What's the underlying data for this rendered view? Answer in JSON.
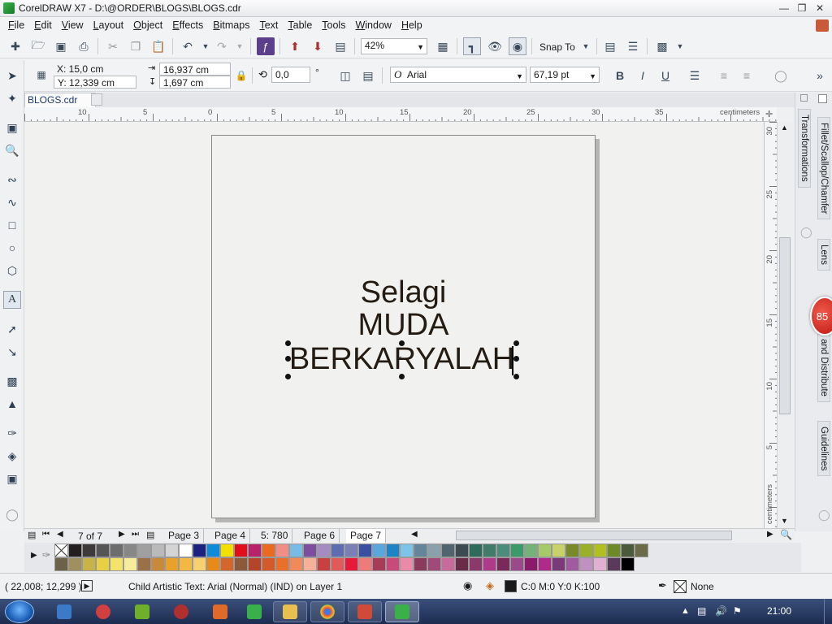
{
  "window": {
    "title": "CorelDRAW X7 - D:\\@ORDER\\BLOGS\\BLOGS.cdr"
  },
  "menu": [
    "File",
    "Edit",
    "View",
    "Layout",
    "Object",
    "Effects",
    "Bitmaps",
    "Text",
    "Table",
    "Tools",
    "Window",
    "Help"
  ],
  "toolbar": {
    "zoom": "42%",
    "snap_to": "Snap To"
  },
  "properties": {
    "x": "X: 15,0 cm",
    "y": "Y: 12,339 cm",
    "width": "16,937 cm",
    "height": "1,697 cm",
    "rotation": "0,0",
    "degree_symbol": "°",
    "font_name": "Arial",
    "font_size": "67,19 pt"
  },
  "document_tab": "BLOGS.cdr",
  "ruler": {
    "h_labels": [
      "10",
      "5",
      "0",
      "5",
      "10",
      "15",
      "20",
      "25",
      "30",
      "35"
    ],
    "unit": "centimeters",
    "v_labels": [
      "30",
      "25",
      "20",
      "15",
      "10",
      "5"
    ]
  },
  "artwork": {
    "lines": [
      "Selagi",
      "MUDA",
      "BERKARYALAH"
    ],
    "text_color": "#241c12"
  },
  "pages": {
    "counter": "7 of 7",
    "tabs": [
      "Page 3",
      "Page 4",
      "5: 780",
      "Page 6",
      "Page 7"
    ],
    "active": "Page 7"
  },
  "dockers": [
    "Transformations",
    "Fillet/Scallop/Chamfer",
    "Lens",
    "and Distribute",
    "Guidelines"
  ],
  "badge": "85",
  "palette": {
    "row1": [
      "#231f20",
      "#3d3a39",
      "#555",
      "#6d6d6d",
      "#878787",
      "#a0a0a0",
      "#bababa",
      "#d4d4d4",
      "#ffffff",
      "#1a237e",
      "#0d8bd9",
      "#f2e100",
      "#e10f1a",
      "#b8226b",
      "#ea6b1f",
      "#f08d87",
      "#78bce6",
      "#7d4e9e",
      "#a48bc2",
      "#5e6cb0",
      "#7b7fb8",
      "#3b4fa0",
      "#5ba6dc",
      "#1f84c6",
      "#7ec3e8",
      "#64869b",
      "#8aa0ad",
      "#52646d",
      "#3e4a52",
      "#2f6b5a",
      "#417c6a",
      "#4b8d7a",
      "#3a9a6a",
      "#74b27a",
      "#a8c96a",
      "#c7d36a",
      "#7a8a2a",
      "#9aaf2a",
      "#b0c020",
      "#6e8a26",
      "#4a5a3a",
      "#6b6b4a"
    ],
    "row2": [
      "#6b6247",
      "#a09060",
      "#c8b24a",
      "#e8d044",
      "#f3e36a",
      "#f8ec9a",
      "#9a7048",
      "#c68a3a",
      "#e9a12a",
      "#f2b842",
      "#f7d070",
      "#e88a1a",
      "#d4662a",
      "#8a5a3a",
      "#b5452a",
      "#d45a2a",
      "#e8702a",
      "#f08a5a",
      "#f6b09a",
      "#c84040",
      "#e05a5a",
      "#e81a3a",
      "#f07a7a",
      "#a83a5a",
      "#c84a7a",
      "#e88aa8",
      "#8a3a5a",
      "#a04a7a",
      "#c86a9a",
      "#6a2a4a",
      "#8a3a6a",
      "#b03a8a",
      "#7a2a5a",
      "#9a4a8a",
      "#8a1a6a",
      "#b02a8a",
      "#7a3a7a",
      "#a05aa0",
      "#c090c0",
      "#e0b0d0",
      "#5a3a5a",
      "#000000"
    ]
  },
  "status": {
    "coords": "( 22,008; 12,299 )",
    "object_info": "Child Artistic Text: Arial (Normal) (IND) on Layer 1",
    "fill": "C:0 M:0 Y:0 K:100",
    "outline": "None"
  },
  "taskbar": {
    "time": "21:00"
  }
}
